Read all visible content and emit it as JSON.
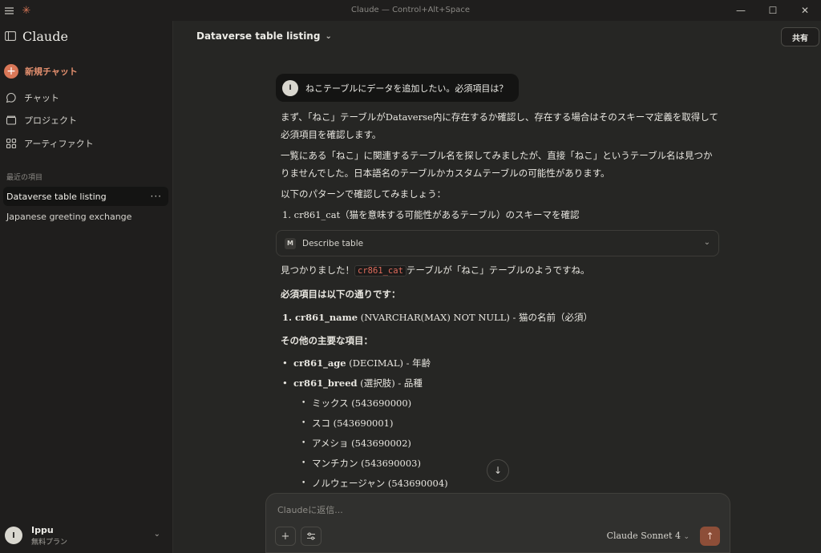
{
  "window": {
    "title": "Claude — Control+Alt+Space"
  },
  "sidebar": {
    "brand": "Claude",
    "new_chat": "新規チャット",
    "nav": [
      "チャット",
      "プロジェクト",
      "アーティファクト"
    ],
    "recent_heading": "最近の項目",
    "recent": [
      "Dataverse table listing",
      "Japanese greeting exchange"
    ],
    "more_dots": "···",
    "user": {
      "initial": "I",
      "name": "Ippu",
      "plan": "無料プラン"
    }
  },
  "header": {
    "chat_title": "Dataverse table listing",
    "share": "共有"
  },
  "conversation": {
    "user_initial": "I",
    "user_message": "ねこテーブルにデータを追加したい。必須項目は？",
    "para1": "まず、「ねこ」テーブルがDataverse内に存在するか確認し、存在する場合はそのスキーマ定義を取得して必須項目を確認します。",
    "para2": "一覧にある「ねこ」に関連するテーブル名を探してみましたが、直接「ねこ」というテーブル名は見つかりませんでした。日本語名のテーブルかカスタムテーブルの可能性があります。",
    "para3": "以下のパターンで確認してみましょう：",
    "step1": "1. cr861_cat（猫を意味する可能性があるテーブル）のスキーマを確認",
    "tool_icon": "M",
    "tool_label": "Describe table",
    "found_prefix": "見つかりました！",
    "found_code": "cr861_cat",
    "found_suffix": "テーブルが「ねこ」テーブルのようですね。",
    "required_heading": "必須項目は以下の通りです：",
    "required_field": "1. cr861_name",
    "required_desc": " (NVARCHAR(MAX) NOT NULL) - 猫の名前（必須）",
    "other_heading": "その他の主要な項目：",
    "age_field": "cr861_age",
    "age_desc": " (DECIMAL) - 年齢",
    "breed_field": "cr861_breed",
    "breed_desc": " (選択肢) - 品種",
    "breeds": [
      "ミックス (543690000)",
      "スコ (543690001)",
      "アメショ (543690002)",
      "マンチカン (543690003)",
      "ノルウェージャン (543690004)"
    ]
  },
  "composer": {
    "placeholder": "Claudeに返信...",
    "model": "Claude Sonnet 4"
  }
}
